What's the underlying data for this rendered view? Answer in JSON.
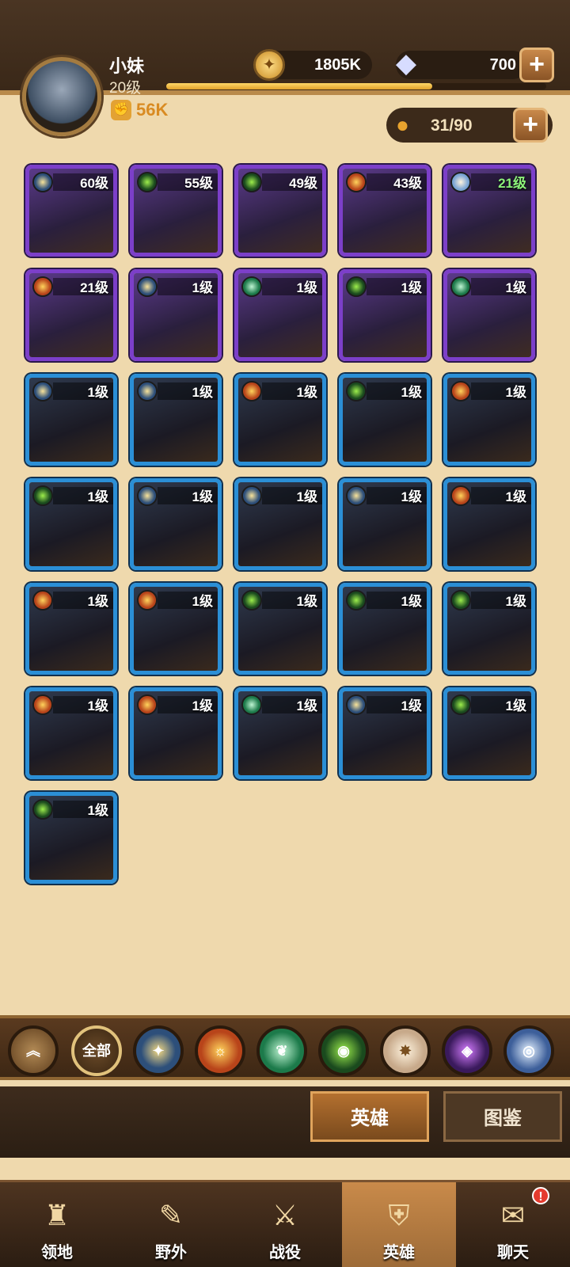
{
  "player": {
    "name": "小妹",
    "level": "20级",
    "power": "56K",
    "xp_progress": 0.7
  },
  "resources": {
    "gold": "1805K",
    "diamonds": "700",
    "hero_capacity": "31/90"
  },
  "heroes": [
    {
      "level": "60级",
      "rarity": "purple",
      "faction": "light"
    },
    {
      "level": "55级",
      "rarity": "purple",
      "faction": "forest"
    },
    {
      "level": "49级",
      "rarity": "purple",
      "faction": "forest"
    },
    {
      "level": "43级",
      "rarity": "purple",
      "faction": "fortress"
    },
    {
      "level": "21级",
      "rarity": "purple",
      "faction": "celestial"
    },
    {
      "level": "21级",
      "rarity": "purple",
      "faction": "fortress"
    },
    {
      "level": "1级",
      "rarity": "purple",
      "faction": "light"
    },
    {
      "level": "1级",
      "rarity": "purple",
      "faction": "nature"
    },
    {
      "level": "1级",
      "rarity": "purple",
      "faction": "forest"
    },
    {
      "level": "1级",
      "rarity": "purple",
      "faction": "nature"
    },
    {
      "level": "1级",
      "rarity": "blue",
      "faction": "light"
    },
    {
      "level": "1级",
      "rarity": "blue",
      "faction": "light"
    },
    {
      "level": "1级",
      "rarity": "blue",
      "faction": "fortress"
    },
    {
      "level": "1级",
      "rarity": "blue",
      "faction": "forest"
    },
    {
      "level": "1级",
      "rarity": "blue",
      "faction": "fortress"
    },
    {
      "level": "1级",
      "rarity": "blue",
      "faction": "forest"
    },
    {
      "level": "1级",
      "rarity": "blue",
      "faction": "light"
    },
    {
      "level": "1级",
      "rarity": "blue",
      "faction": "light"
    },
    {
      "level": "1级",
      "rarity": "blue",
      "faction": "light"
    },
    {
      "level": "1级",
      "rarity": "blue",
      "faction": "fortress"
    },
    {
      "level": "1级",
      "rarity": "blue",
      "faction": "fortress"
    },
    {
      "level": "1级",
      "rarity": "blue",
      "faction": "fortress"
    },
    {
      "level": "1级",
      "rarity": "blue",
      "faction": "forest"
    },
    {
      "level": "1级",
      "rarity": "blue",
      "faction": "forest"
    },
    {
      "level": "1级",
      "rarity": "blue",
      "faction": "forest"
    },
    {
      "level": "1级",
      "rarity": "blue",
      "faction": "fortress"
    },
    {
      "level": "1级",
      "rarity": "blue",
      "faction": "fortress"
    },
    {
      "level": "1级",
      "rarity": "blue",
      "faction": "nature"
    },
    {
      "level": "1级",
      "rarity": "blue",
      "faction": "light"
    },
    {
      "level": "1级",
      "rarity": "blue",
      "faction": "forest"
    },
    {
      "level": "1级",
      "rarity": "blue",
      "faction": "forest"
    }
  ],
  "filters": {
    "collapse_icon": "chevron-up-icon",
    "all_label": "全部",
    "factions": [
      "light",
      "fortress",
      "nature",
      "forest",
      "celestial",
      "dark",
      "mechanical"
    ]
  },
  "subtabs": {
    "heroes": "英雄",
    "codex": "图鉴"
  },
  "nav": {
    "territory": "领地",
    "wild": "野外",
    "campaign": "战役",
    "heroes": "英雄",
    "chat": "聊天",
    "chat_badge": "!"
  },
  "colors": {
    "purple_frame": "#7c3fc9",
    "blue_frame": "#2b8fd6",
    "gold_text": "#d98b22"
  }
}
